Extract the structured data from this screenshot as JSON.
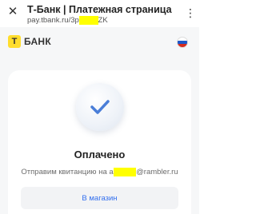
{
  "toolbar": {
    "close_icon": "close-icon",
    "title": "Т-Банк | Платежная страница",
    "url_prefix": "pay.tbank.ru/3p",
    "url_masked": "xxxxx",
    "url_suffix": "ZK",
    "menu_icon": "more-vert-icon"
  },
  "header": {
    "logo_mark": "Т",
    "logo_text": "БАНК",
    "flag_icon": "russia-flag-icon"
  },
  "payment": {
    "status_icon": "checkmark-icon",
    "status_title": "Оплачено",
    "receipt_prefix": "Отправим квитанцию на a",
    "receipt_masked": "xxxxxx",
    "receipt_suffix": "@rambler.ru",
    "shop_button_label": "В магазин"
  },
  "colors": {
    "accent": "#336fee",
    "brand_yellow": "#ffdd2d",
    "background": "#f6f7f8"
  }
}
